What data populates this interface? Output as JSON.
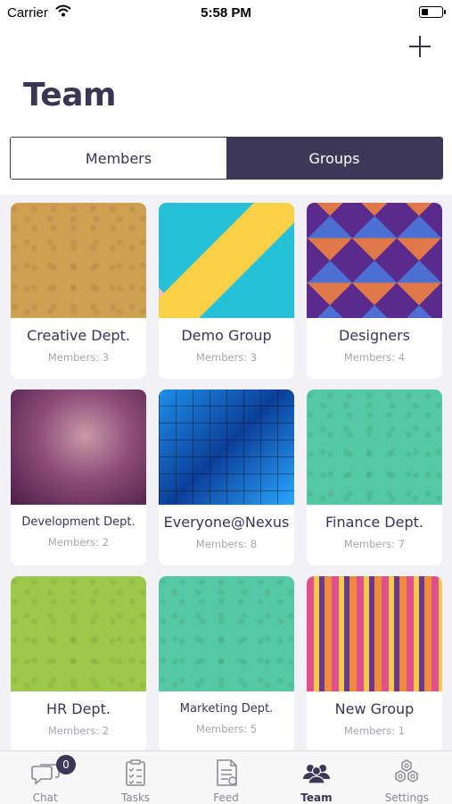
{
  "status_bar": {
    "carrier": "Carrier",
    "time": "5:58 PM",
    "battery_level": 0.35
  },
  "header": {
    "title": "Team",
    "add_icon": "plus-icon"
  },
  "segmented": {
    "members_label": "Members",
    "groups_label": "Groups",
    "selected": "Groups"
  },
  "groups": [
    {
      "name": "Creative Dept.",
      "members": "Members: 3",
      "image": "pattern-orange"
    },
    {
      "name": "Demo Group",
      "members": "Members: 3",
      "image": "memphis-triangles"
    },
    {
      "name": "Designers",
      "members": "Members: 4",
      "image": "purple-diamonds"
    },
    {
      "name": "Development Dept.",
      "members": "Members: 2",
      "image": "purple-texture"
    },
    {
      "name": "Everyone@Nexus",
      "members": "Members: 8",
      "image": "blue-tiles"
    },
    {
      "name": "Finance Dept.",
      "members": "Members: 7",
      "image": "pattern-teal"
    },
    {
      "name": "HR Dept.",
      "members": "Members: 2",
      "image": "pattern-green"
    },
    {
      "name": "Marketing Dept.",
      "members": "Members: 5",
      "image": "pattern-teal"
    },
    {
      "name": "New Group",
      "members": "Members: 1",
      "image": "tribal-pattern"
    }
  ],
  "tab_bar": {
    "items": [
      {
        "label": "Chat",
        "icon": "chat-icon",
        "badge": "0"
      },
      {
        "label": "Tasks",
        "icon": "tasks-icon"
      },
      {
        "label": "Feed",
        "icon": "feed-icon"
      },
      {
        "label": "Team",
        "icon": "team-icon",
        "active": true
      },
      {
        "label": "Settings",
        "icon": "settings-icon"
      }
    ]
  },
  "colors": {
    "primary": "#3d3857",
    "background": "#f2f2f6",
    "muted": "#a6a6ae"
  }
}
